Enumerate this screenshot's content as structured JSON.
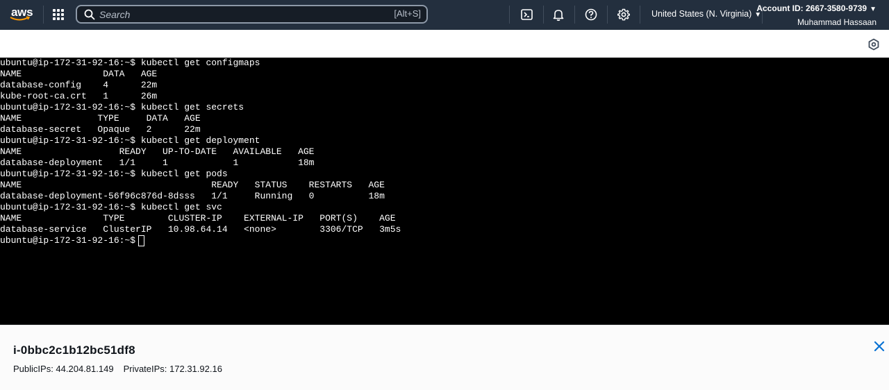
{
  "topnav": {
    "logo_text": "aws",
    "search_placeholder": "Search",
    "search_shortcut": "[Alt+S]",
    "icons": [
      "apps-grid-icon",
      "search-icon",
      "cloudshell-icon",
      "bell-icon",
      "help-icon",
      "gear-icon"
    ],
    "region": "United States (N. Virginia)",
    "account_id": "Account ID: 2667-3580-9739",
    "user": "Muhammad Hassaan"
  },
  "terminal": {
    "lines": [
      "ubuntu@ip-172-31-92-16:~$ kubectl get configmaps",
      "NAME               DATA   AGE",
      "database-config    4      22m",
      "kube-root-ca.crt   1      26m",
      "ubuntu@ip-172-31-92-16:~$ kubectl get secrets",
      "NAME              TYPE     DATA   AGE",
      "database-secret   Opaque   2      22m",
      "ubuntu@ip-172-31-92-16:~$ kubectl get deployment",
      "NAME                  READY   UP-TO-DATE   AVAILABLE   AGE",
      "database-deployment   1/1     1            1           18m",
      "ubuntu@ip-172-31-92-16:~$ kubectl get pods",
      "NAME                                   READY   STATUS    RESTARTS   AGE",
      "database-deployment-56f96c876d-8dsss   1/1     Running   0          18m",
      "ubuntu@ip-172-31-92-16:~$ kubectl get svc",
      "NAME               TYPE        CLUSTER-IP    EXTERNAL-IP   PORT(S)    AGE",
      "database-service   ClusterIP   10.98.64.14   <none>        3306/TCP   3m5s"
    ],
    "prompt": "ubuntu@ip-172-31-92-16:~$"
  },
  "instance": {
    "id": "i-0bbc2c1b12bc51df8",
    "public_ips": "PublicIPs: 44.204.81.149",
    "private_ips": "PrivateIPs: 172.31.92.16"
  },
  "colors": {
    "nav_bg": "#232f3e",
    "terminal_bg": "#000000",
    "link_blue": "#0972d3"
  }
}
